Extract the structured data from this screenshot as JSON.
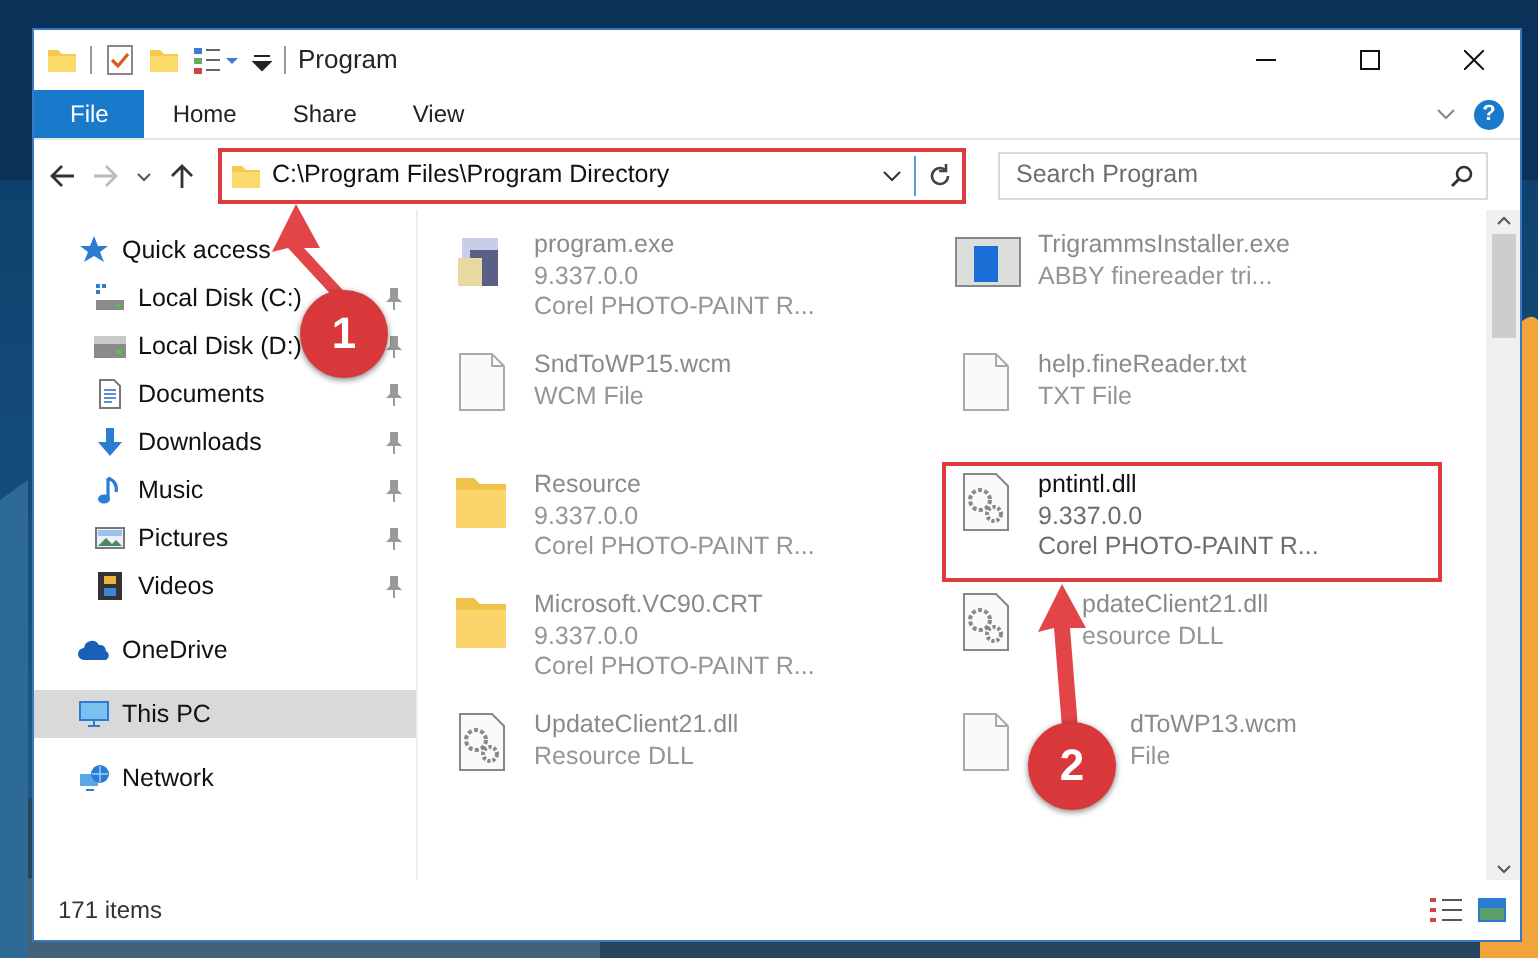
{
  "window": {
    "title": "Program"
  },
  "ribbon_tabs": [
    {
      "label": "File",
      "kind": "file",
      "selected": false
    },
    {
      "label": "Home",
      "kind": "tab",
      "selected": false
    },
    {
      "label": "Share",
      "kind": "tab",
      "selected": false
    },
    {
      "label": "View",
      "kind": "tab",
      "selected": false
    }
  ],
  "help_button": "?",
  "address": {
    "path": "C:\\Program Files\\Program Directory",
    "highlighted": true
  },
  "search": {
    "placeholder": "Search Program"
  },
  "sidebar": [
    {
      "label": "Quick access",
      "kind": "star",
      "selected": false,
      "children": [
        {
          "label": "Local Disk (C:)",
          "kind": "diskc",
          "pinned": true
        },
        {
          "label": "Local Disk (D:)",
          "kind": "disk",
          "pinned": true
        },
        {
          "label": "Documents",
          "kind": "docs",
          "pinned": true
        },
        {
          "label": "Downloads",
          "kind": "download",
          "pinned": true
        },
        {
          "label": "Music",
          "kind": "music",
          "pinned": true
        },
        {
          "label": "Pictures",
          "kind": "pictures",
          "pinned": true
        },
        {
          "label": "Videos",
          "kind": "videos",
          "pinned": true
        }
      ]
    },
    {
      "label": "OneDrive",
      "kind": "cloud",
      "selected": false
    },
    {
      "label": "This PC",
      "kind": "pc",
      "selected": true
    },
    {
      "label": "Network",
      "kind": "network",
      "selected": false
    }
  ],
  "files": [
    {
      "name": "program.exe",
      "details": [
        "9.337.0.0",
        "Corel PHOTO-PAINT R..."
      ],
      "kind": "program",
      "blurred": true,
      "highlighted": false
    },
    {
      "name": "TrigrammsInstaller.exe",
      "details": [
        "ABBY finereader tri..."
      ],
      "kind": "installer",
      "blurred": true,
      "highlighted": false
    },
    {
      "name": "SndToWP15.wcm",
      "details": [
        "WCM File"
      ],
      "kind": "document",
      "blurred": true,
      "highlighted": false
    },
    {
      "name": "help.fineReader.txt",
      "details": [
        "TXT File"
      ],
      "kind": "document",
      "blurred": true,
      "highlighted": false
    },
    {
      "name": "Resource",
      "details": [
        "9.337.0.0",
        "Corel PHOTO-PAINT R..."
      ],
      "kind": "folder",
      "blurred": true,
      "highlighted": false
    },
    {
      "name": "pntintl.dll",
      "details": [
        "9.337.0.0",
        "Corel PHOTO-PAINT R..."
      ],
      "kind": "settings",
      "blurred": false,
      "highlighted": true
    },
    {
      "name": "Microsoft.VC90.CRT",
      "details": [
        "9.337.0.0",
        "Corel PHOTO-PAINT R..."
      ],
      "kind": "folder",
      "blurred": true,
      "highlighted": false
    },
    {
      "name": "pdateClient21.dll",
      "details": [
        "esource DLL"
      ],
      "kind": "settings",
      "blurred": true,
      "highlighted": false
    },
    {
      "name": "UpdateClient21.dll",
      "details": [
        "Resource DLL"
      ],
      "kind": "settings",
      "blurred": true,
      "highlighted": false
    },
    {
      "name": "dToWP13.wcm",
      "details": [
        "File"
      ],
      "kind": "document",
      "blurred": true,
      "highlighted": false
    }
  ],
  "status_bar": {
    "count": "171 items"
  },
  "annotations": [
    {
      "number": "1"
    },
    {
      "number": "2"
    }
  ]
}
